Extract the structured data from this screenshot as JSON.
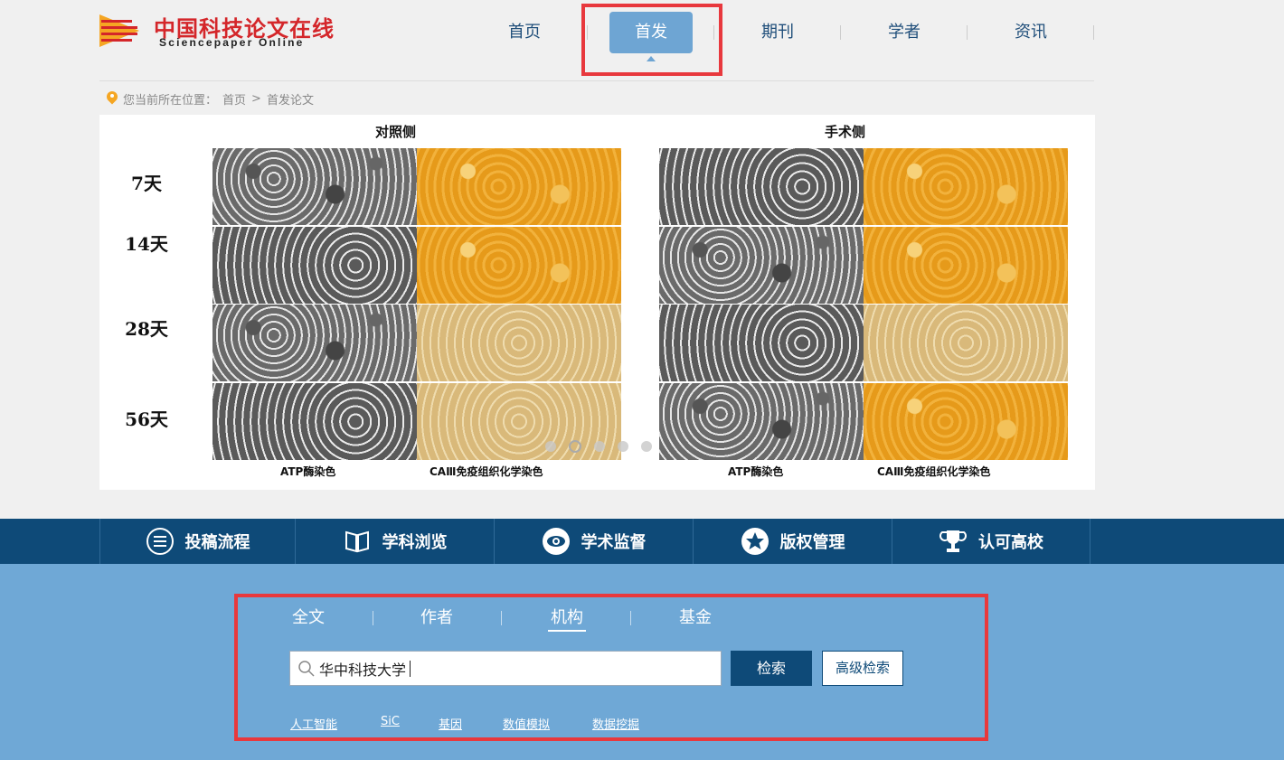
{
  "header": {
    "logo_cn": "中国科技论文在线",
    "logo_en": "Sciencepaper Online",
    "nav": [
      {
        "label": "首页"
      },
      {
        "label": "首发"
      },
      {
        "label": "期刊"
      },
      {
        "label": "学者"
      },
      {
        "label": "资讯"
      }
    ],
    "active_nav": "首发"
  },
  "breadcrumb": {
    "prefix": "您当前所在位置：",
    "home": "首页",
    "sep": ">",
    "current": "首发论文"
  },
  "banner": {
    "col_left": "对照侧",
    "col_right": "手术侧",
    "rows": [
      "7天",
      "14天",
      "28天",
      "56天"
    ],
    "caption_atp": "ATP酶染色",
    "caption_ca": "CAⅢ免疫组织化学染色",
    "slide_count": 5,
    "active_slide": 2
  },
  "features": [
    {
      "label": "投稿流程",
      "icon": "list-icon"
    },
    {
      "label": "学科浏览",
      "icon": "book-icon"
    },
    {
      "label": "学术监督",
      "icon": "eye-icon"
    },
    {
      "label": "版权管理",
      "icon": "star-icon"
    },
    {
      "label": "认可高校",
      "icon": "trophy-icon"
    }
  ],
  "search": {
    "tabs": [
      "全文",
      "作者",
      "机构",
      "基金"
    ],
    "active_tab": "机构",
    "value": "华中科技大学",
    "search_label": "检索",
    "advanced_label": "高级检索",
    "hot_keywords": [
      "人工智能",
      "SiC",
      "基因",
      "数值模拟",
      "数据挖掘"
    ]
  },
  "colors": {
    "brand_red": "#d4262a",
    "nav_active": "#6ea5d3",
    "strip_bg": "#0e4a78",
    "search_bg": "#6fa8d6",
    "highlight": "#e8383d"
  }
}
